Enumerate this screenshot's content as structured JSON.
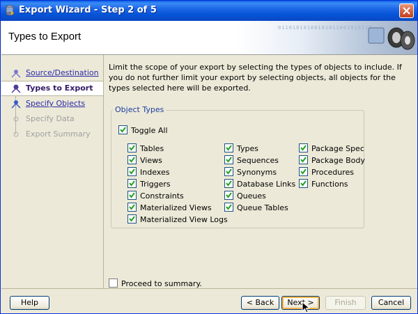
{
  "window": {
    "title": "Export Wizard - Step 2 of 5"
  },
  "header": {
    "title": "Types to Export",
    "art_text": "01101010100101011001010110"
  },
  "steps": [
    {
      "label": "Source/Destination",
      "state": "link"
    },
    {
      "label": "Types to Export",
      "state": "current"
    },
    {
      "label": "Specify Objects",
      "state": "link"
    },
    {
      "label": "Specify Data",
      "state": "disabled"
    },
    {
      "label": "Export Summary",
      "state": "disabled"
    }
  ],
  "description": "Limit the scope of your export by selecting the types of objects to include.  If you do not further limit your export by selecting objects, all objects for the types selected here will be exported.",
  "object_types": {
    "legend": "Object Types",
    "toggle_all": {
      "label": "Toggle All",
      "checked": true
    },
    "col1": [
      {
        "label": "Tables",
        "checked": true
      },
      {
        "label": "Views",
        "checked": true
      },
      {
        "label": "Indexes",
        "checked": true
      },
      {
        "label": "Triggers",
        "checked": true
      },
      {
        "label": "Constraints",
        "checked": true
      },
      {
        "label": "Materialized Views",
        "checked": true
      },
      {
        "label": "Materialized View Logs",
        "checked": true
      }
    ],
    "col2": [
      {
        "label": "Types",
        "checked": true
      },
      {
        "label": "Sequences",
        "checked": true
      },
      {
        "label": "Synonyms",
        "checked": true
      },
      {
        "label": "Database Links",
        "checked": true
      },
      {
        "label": "Queues",
        "checked": true
      },
      {
        "label": "Queue Tables",
        "checked": true
      }
    ],
    "col3": [
      {
        "label": "Package Spec",
        "checked": true
      },
      {
        "label": "Package Body",
        "checked": true
      },
      {
        "label": "Procedures",
        "checked": true
      },
      {
        "label": "Functions",
        "checked": true
      }
    ]
  },
  "proceed": {
    "label": "Proceed to summary.",
    "checked": false
  },
  "buttons": {
    "help": "Help",
    "back": "< Back",
    "next": "Next >",
    "finish": "Finish",
    "cancel": "Cancel"
  },
  "colors": {
    "titlebar": "#0a5fe3",
    "link": "#2a2aa8",
    "current_step": "#331a66",
    "legend": "#1c3ea0"
  }
}
